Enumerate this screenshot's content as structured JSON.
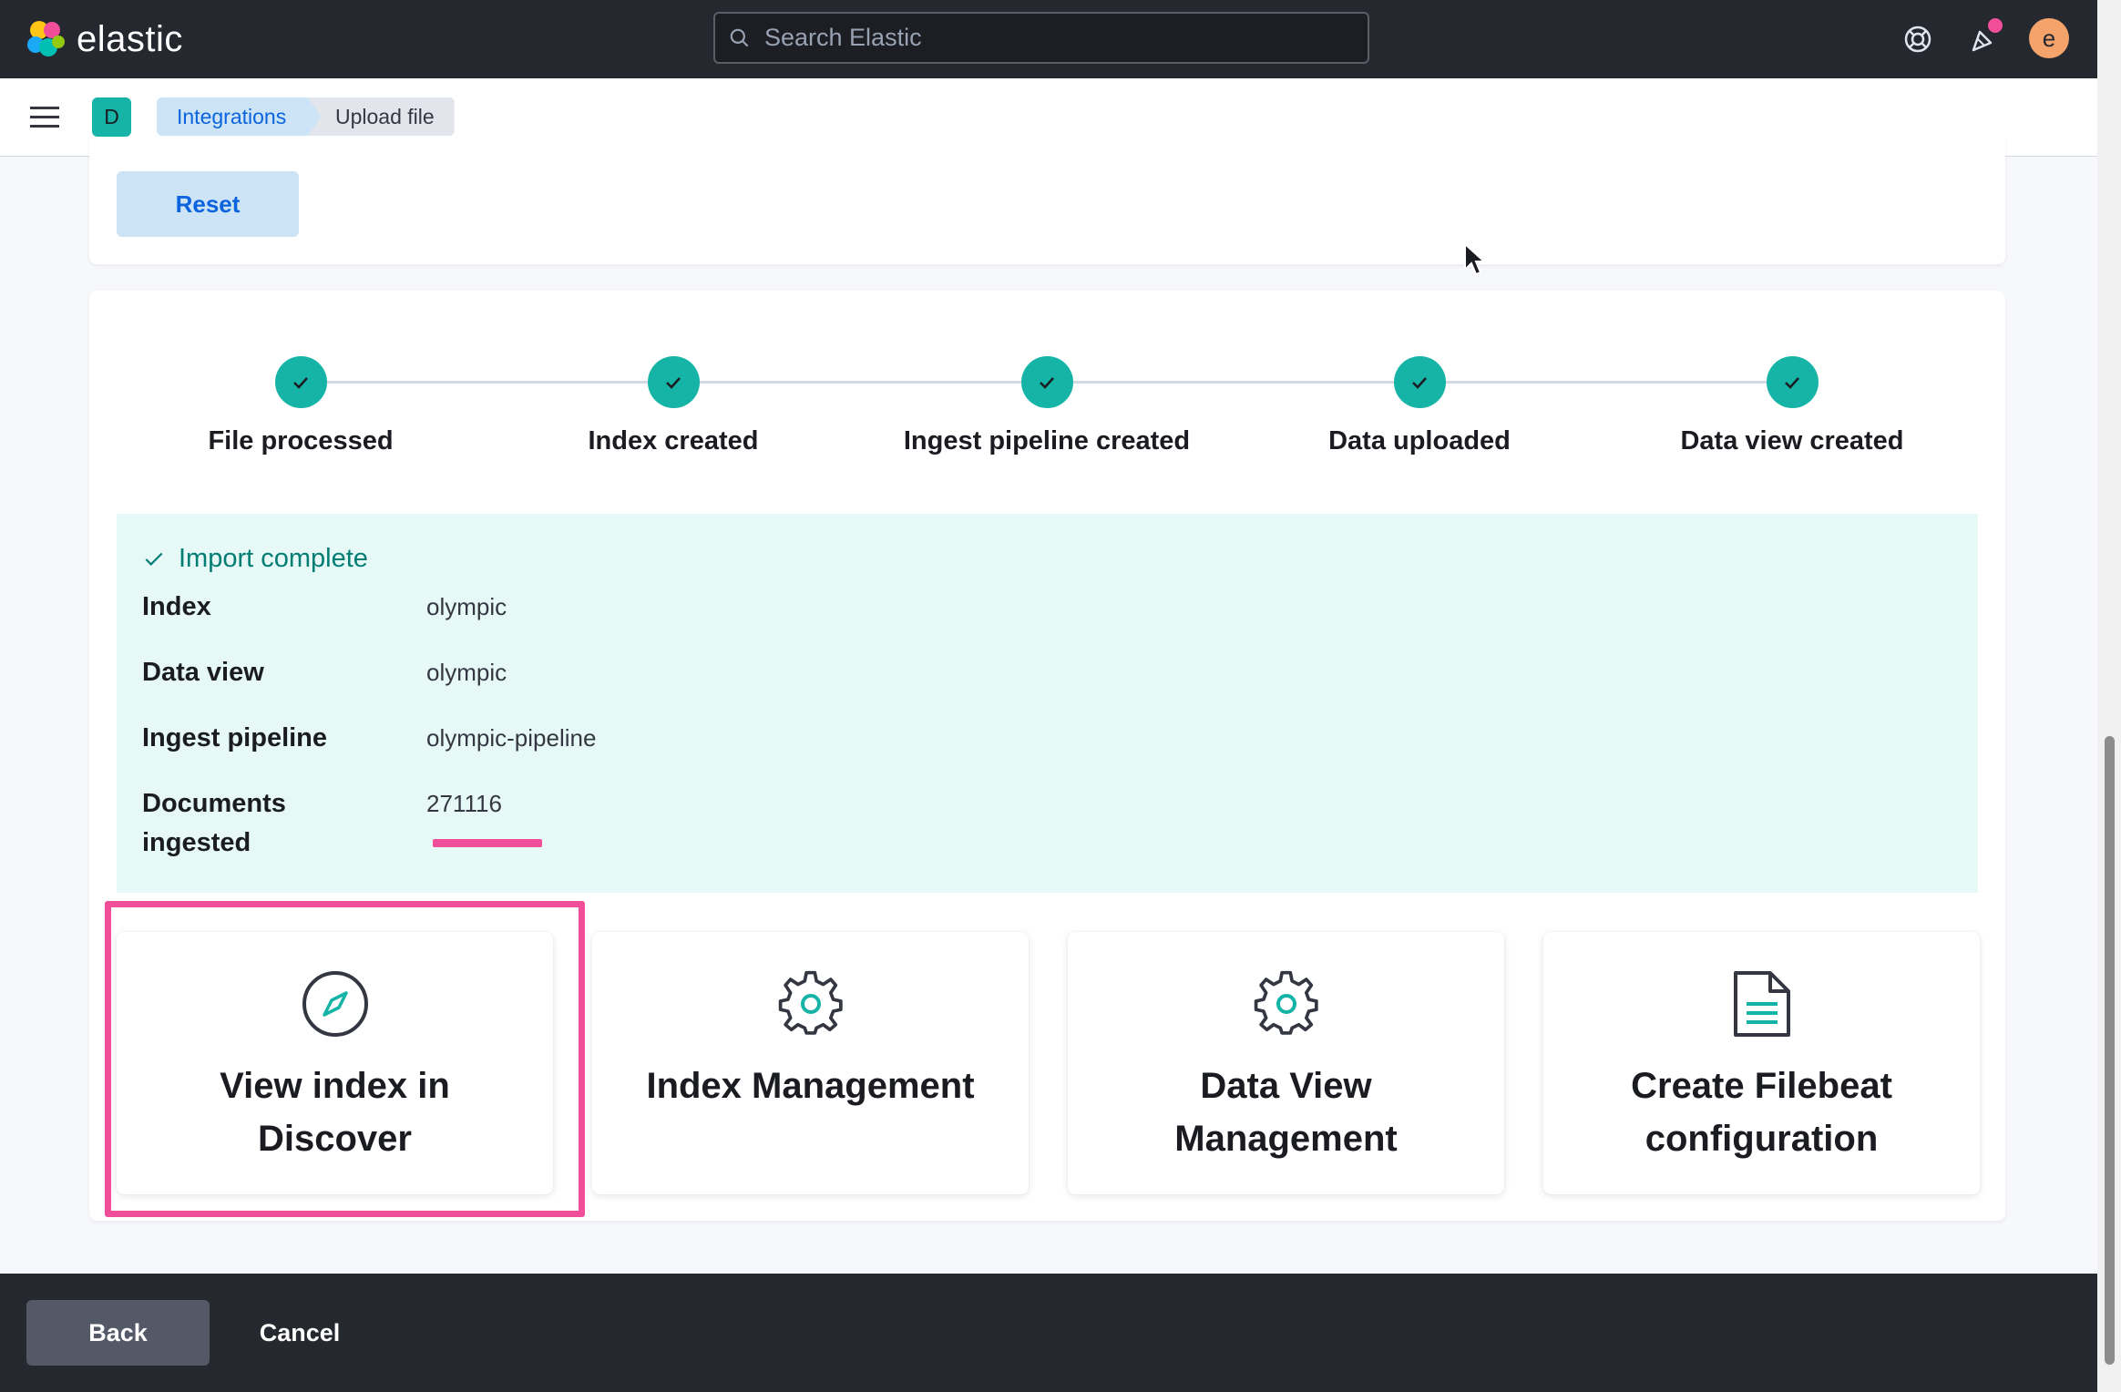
{
  "header": {
    "logo_text": "elastic",
    "search_placeholder": "Search Elastic",
    "avatar_initial": "e"
  },
  "subheader": {
    "space_initial": "D",
    "breadcrumbs": [
      "Integrations",
      "Upload file"
    ]
  },
  "top_panel": {
    "reset_label": "Reset"
  },
  "steps": [
    "File processed",
    "Index created",
    "Ingest pipeline created",
    "Data uploaded",
    "Data view created"
  ],
  "import": {
    "title": "Import complete",
    "rows": [
      {
        "key": "Index",
        "value": "olympic"
      },
      {
        "key": "Data view",
        "value": "olympic"
      },
      {
        "key": "Ingest pipeline",
        "value": "olympic-pipeline"
      },
      {
        "key": "Documents ingested",
        "value": "271116"
      }
    ]
  },
  "cards": [
    {
      "title": "View index in Discover",
      "icon": "compass-icon"
    },
    {
      "title": "Index Management",
      "icon": "gear-icon"
    },
    {
      "title": "Data View Management",
      "icon": "gear-icon"
    },
    {
      "title": "Create Filebeat configuration",
      "icon": "document-icon"
    }
  ],
  "footer": {
    "back_label": "Back",
    "cancel_label": "Cancel"
  },
  "colors": {
    "accent_teal": "#16b4a7",
    "highlight_pink": "#f04e98",
    "header_dark": "#25282f"
  }
}
